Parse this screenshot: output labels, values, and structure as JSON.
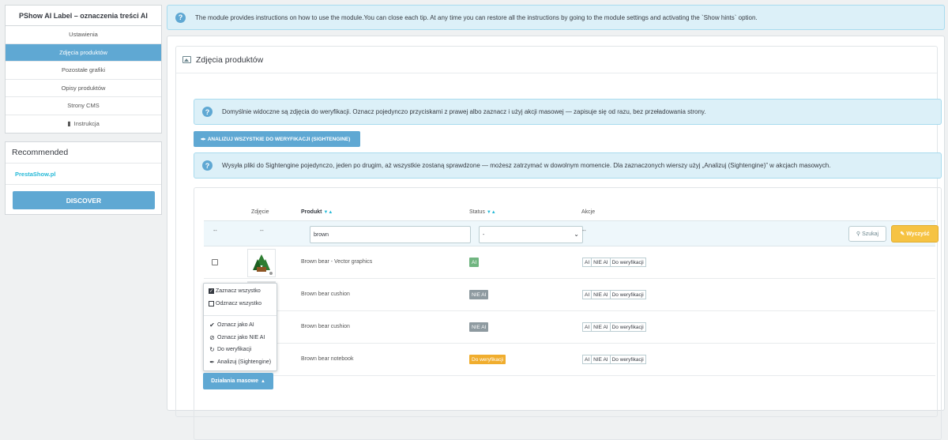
{
  "sidebar": {
    "title": "PShow AI Label – oznaczenia treści AI",
    "items": [
      {
        "label": "Ustawienia"
      },
      {
        "label": "Zdjęcia produktów",
        "active": true
      },
      {
        "label": "Pozostałe grafiki"
      },
      {
        "label": "Opisy produktów"
      },
      {
        "label": "Strony CMS"
      },
      {
        "label": "Instrukcja",
        "icon": "book-icon"
      }
    ]
  },
  "recommended": {
    "title": "Recommended",
    "link": "PrestaShow.pl",
    "button": "DISCOVER"
  },
  "hint_top": "The module provides instructions on how to use the module.You can close each tip. At any time you can restore all the instructions by going to the module settings and activating the `Show hints` option.",
  "panel": {
    "title": "Zdjęcia produktów",
    "alert1": "Domyślnie widoczne są zdjęcia do weryfikacji. Oznacz pojedynczo przyciskami z prawej albo zaznacz i użyj akcji masowej — zapisuje się od razu, bez przeładowania strony.",
    "analyze_button": "ANALIZUJ WSZYSTKIE DO WERYFIKACJI (SIGHTENGINE)",
    "alert2": "Wysyła pliki do Sightengine pojedynczo, jeden po drugim, aż wszystkie zostaną sprawdzone — możesz zatrzymać w dowolnym momencie. Dla zaznaczonych wierszy użyj „Analizuj (Sightengine)” w akcjach masowych."
  },
  "table": {
    "headers": {
      "image": "Zdjęcie",
      "product": "Produkt",
      "status": "Status",
      "actions": "Akcje"
    },
    "sort_arrows": "▼▲",
    "filter": {
      "dash": "--",
      "search_value": "brown",
      "status_value": "-",
      "search_button": "Szukaj",
      "clear_button": "Wyczyść"
    },
    "action_labels": [
      "AI",
      "NIE AI",
      "Do weryfikacji"
    ],
    "rows": [
      {
        "name": "Brown bear - Vector graphics",
        "status": "AI",
        "status_type": "ai"
      },
      {
        "name": "Brown bear cushion",
        "status": "NIE AI",
        "status_type": "nie"
      },
      {
        "name": "Brown bear cushion",
        "status": "NIE AI",
        "status_type": "nie"
      },
      {
        "name": "Brown bear notebook",
        "status": "Do weryfikacji",
        "status_type": "dow"
      }
    ]
  },
  "bulk": {
    "button": "Działania masowe",
    "items": {
      "select_all": "Zaznacz wszystko",
      "deselect_all": "Odznacz wszystko",
      "mark_ai": "Oznacz jako AI",
      "mark_not_ai": "Oznacz jako NIE AI",
      "to_verify": "Do weryfikacji",
      "analyze": "Analizuj (Sightengine)"
    }
  },
  "colors": {
    "accent": "#5fa8d3",
    "warning": "#f6c343",
    "ai_badge": "#70b580",
    "not_ai_badge": "#8e9aa0",
    "verify_badge": "#f0ad2e"
  }
}
